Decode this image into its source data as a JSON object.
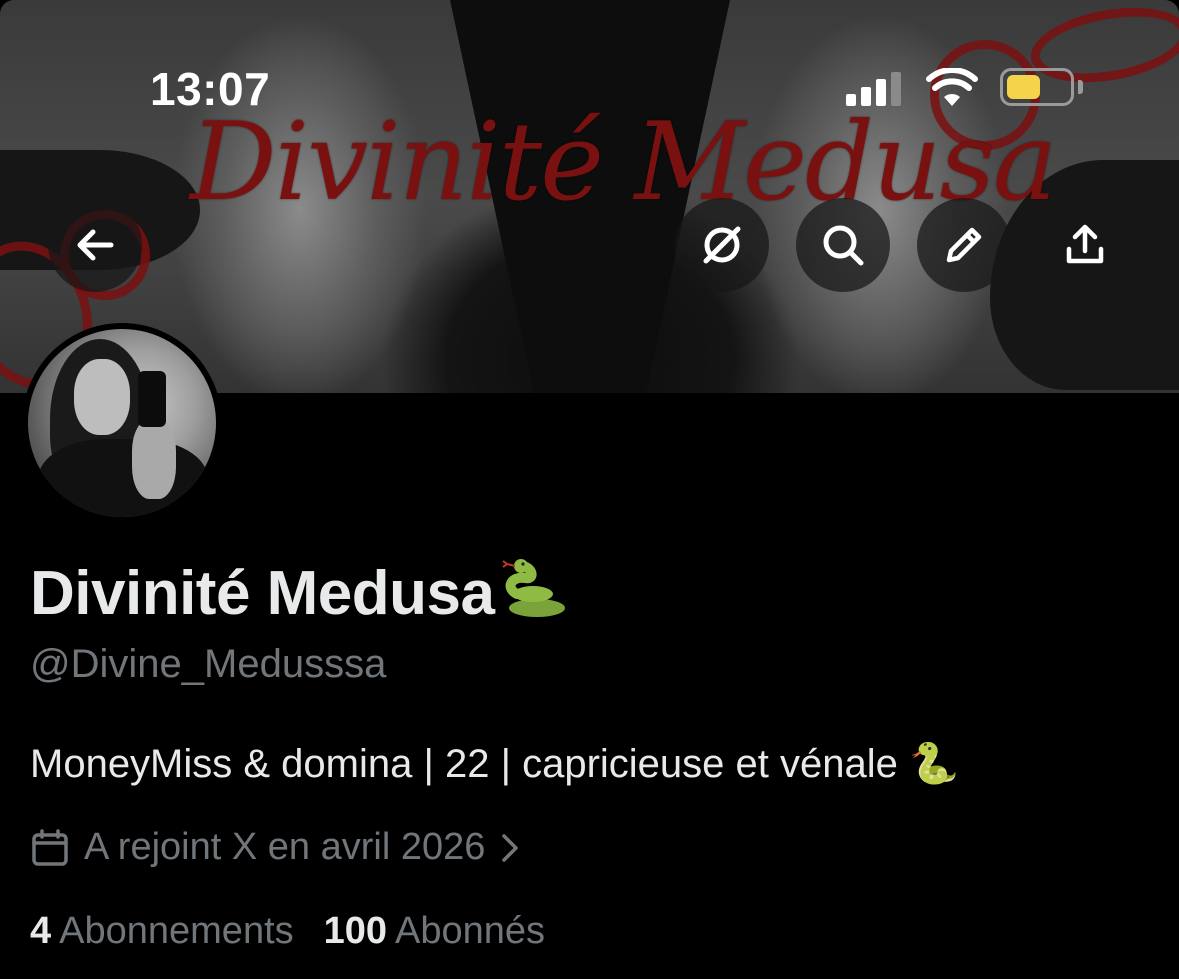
{
  "status_bar": {
    "time": "13:07",
    "battery_level": 0.55,
    "battery_color": "#f4d44a"
  },
  "banner": {
    "title": "Divinité Medusa",
    "title_color": "#7a1111"
  },
  "header_actions": {
    "back_icon": "arrow-left-icon",
    "grok_icon": "grok-icon",
    "search_icon": "search-icon",
    "edit_icon": "pencil-icon",
    "share_icon": "share-icon"
  },
  "profile": {
    "display_name": "Divinité Medusa",
    "name_emoji": "🐍",
    "handle": "@Divine_Medusssa",
    "bio": "MoneyMiss & domina | 22 | capricieuse et vénale 🐍",
    "joined": "A rejoint X en avril 2026",
    "following_count": "4",
    "following_label": "Abonnements",
    "followers_count": "100",
    "followers_label": "Abonnés"
  },
  "colors": {
    "background": "#000000",
    "primary_text": "#e7e9ea",
    "secondary_text": "#71767b"
  }
}
